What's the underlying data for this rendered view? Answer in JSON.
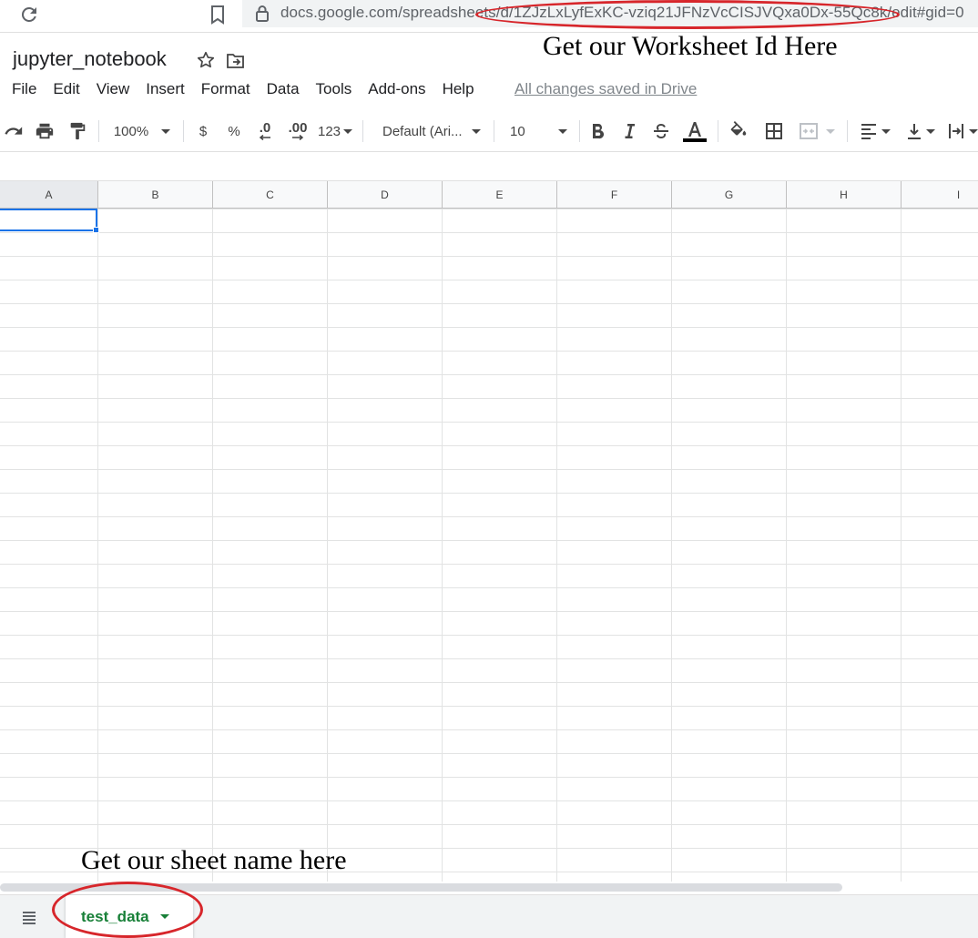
{
  "browser": {
    "url": "docs.google.com/spreadsheets/d/1ZJzLxLyfExKC-vziq21JFNzVcCISJVQxa0Dx-55Qc8k/edit#gid=0"
  },
  "document": {
    "title": "jupyter_notebook",
    "saved_status": "All changes saved in Drive"
  },
  "menu": [
    "File",
    "Edit",
    "View",
    "Insert",
    "Format",
    "Data",
    "Tools",
    "Add-ons",
    "Help"
  ],
  "toolbar": {
    "zoom": "100%",
    "currency": "$",
    "percent": "%",
    "decrease_decimal": ".0",
    "increase_decimal": ".00",
    "more_formats": "123",
    "font": "Default (Ari...",
    "font_size": "10",
    "text_color": "#000000",
    "icons": [
      "redo-icon",
      "print-icon",
      "paint-format-icon",
      "bold-icon",
      "italic-icon",
      "strikethrough-icon",
      "text-color-icon",
      "fill-color-icon",
      "borders-icon",
      "merge-cells-icon",
      "horizontal-align-icon",
      "vertical-align-icon",
      "text-wrap-icon"
    ]
  },
  "columns": [
    "A",
    "B",
    "C",
    "D",
    "E",
    "F",
    "G",
    "H",
    "I"
  ],
  "sheets": [
    {
      "name": "test_data",
      "active": true
    }
  ],
  "annotations": {
    "worksheet_id": "Get our Worksheet Id Here",
    "sheet_name": "Get our sheet name here",
    "highlight_color": "#d7262b"
  },
  "colors": {
    "active_cell": "#1a73e8",
    "sheet_tab_text": "#188038"
  }
}
